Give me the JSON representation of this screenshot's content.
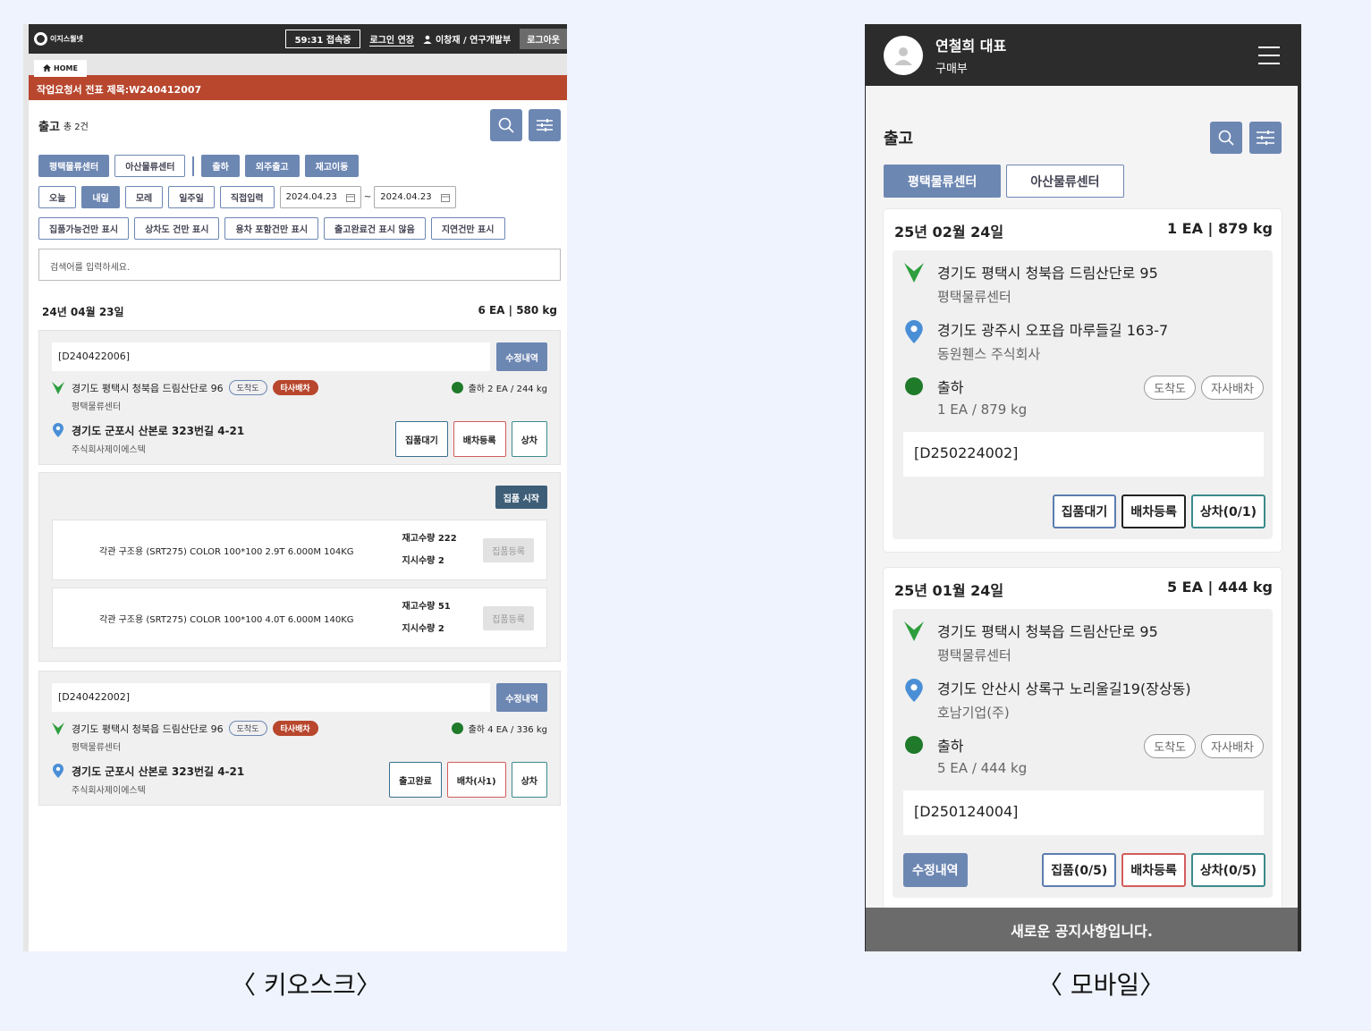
{
  "kiosk": {
    "logo_text": "이지스월넷",
    "timer": "59:31 접속중",
    "extend_label": "로그인 연장",
    "user_label": "이창재 / 연구개발부",
    "logout_label": "로그아웃",
    "home_tab": "HOME",
    "banner": "작업요청서 전표 제목:W240412007",
    "title": "출고",
    "count": "총 2건",
    "centers": [
      "평택물류센터",
      "아산물류센터"
    ],
    "types": [
      "출하",
      "외주출고",
      "재고이동"
    ],
    "periods": [
      "오늘",
      "내일",
      "모레",
      "일주일",
      "직접입력"
    ],
    "date_from": "2024.04.23",
    "date_sep": "~",
    "date_to": "2024.04.23",
    "filters": [
      "집품가능건만 표시",
      "상차도 건만 표시",
      "용차 포함건만 표시",
      "출고완료건 표시 않음",
      "지연건만 표시"
    ],
    "search_placeholder": "검색어를 입력하세요.",
    "date_head": "24년 04월 23일",
    "date_total": "6 EA | 580 kg",
    "orders": [
      {
        "order_no": "[D240422006]",
        "edit_label": "수정내역",
        "origin": "경기도 평택시 청북읍 드림산단로 96",
        "origin_place": "평택물류센터",
        "pill1": "도착도",
        "pill2": "타사배차",
        "ship": "출하 2 EA / 244 kg",
        "dest": "경기도 군포시 산본로 323번길 4-21",
        "dest_place": "주식회사제이에스텍",
        "actions": [
          "집품대기",
          "배차등록",
          "상차"
        ]
      },
      {
        "order_no": "[D240422002]",
        "edit_label": "수정내역",
        "origin": "경기도 평택시 청북읍 드림산단로 96",
        "origin_place": "평택물류센터",
        "pill1": "도착도",
        "pill2": "타사배차",
        "ship": "출하 4 EA / 336 kg",
        "dest": "경기도 군포시 산본로 323번길 4-21",
        "dest_place": "주식회사제이에스텍",
        "actions": [
          "출고완료",
          "배차(사1)",
          "상차"
        ]
      }
    ],
    "pick_start": "집품 시작",
    "items": [
      {
        "name": "각관 구조용 (SRT275) COLOR 100*100 2.9T 6.000M 104KG",
        "stock": "재고수량 222",
        "order": "지시수량 2",
        "reg": "집품등록"
      },
      {
        "name": "각관 구조용 (SRT275) COLOR 100*100 4.0T 6.000M 140KG",
        "stock": "재고수량 51",
        "order": "지시수량 2",
        "reg": "집품등록"
      }
    ],
    "caption": "〈 키오스크〉"
  },
  "mobile": {
    "name": "연철희 대표",
    "dept": "구매부",
    "title": "출고",
    "centers": [
      "평택물류센터",
      "아산물류센터"
    ],
    "cards": [
      {
        "date": "25년 02월 24일",
        "total": "1 EA | 879 kg",
        "origin": "경기도 평택시 청북읍 드림산단로 95",
        "origin_place": "평택물류센터",
        "dest": "경기도 광주시 오포읍 마루들길 163-7",
        "dest_place": "동원휀스 주식회사",
        "ship": "출하",
        "ship_qty": "1 EA / 879 kg",
        "pill1": "도착도",
        "pill2": "자사배차",
        "order_no": "[D250224002]",
        "actions": [
          "집품대기",
          "배차등록",
          "상차(0/1)"
        ]
      },
      {
        "date": "25년 01월 24일",
        "total": "5 EA | 444 kg",
        "origin": "경기도 평택시 청북읍 드림산단로 95",
        "origin_place": "평택물류센터",
        "dest": "경기도 안산시 상록구 노리울길19(장상동)",
        "dest_place": "호남기업(주)",
        "ship": "출하",
        "ship_qty": "5 EA / 444 kg",
        "pill1": "도착도",
        "pill2": "자사배차",
        "order_no": "[D250124004]",
        "edit_label": "수정내역",
        "actions": [
          "집품(0/5)",
          "배차등록",
          "상차(0/5)"
        ]
      }
    ],
    "notice": "새로운 공지사항입니다.",
    "caption": "〈 모바일〉"
  },
  "colors": {
    "accent": "#6d87b3",
    "banner": "#b8472e",
    "dark": "#2c2c2c",
    "ship_dot": "#1f7a2a",
    "origin_icon": "#2e9e3e",
    "dest_icon": "#4a8fd6"
  }
}
